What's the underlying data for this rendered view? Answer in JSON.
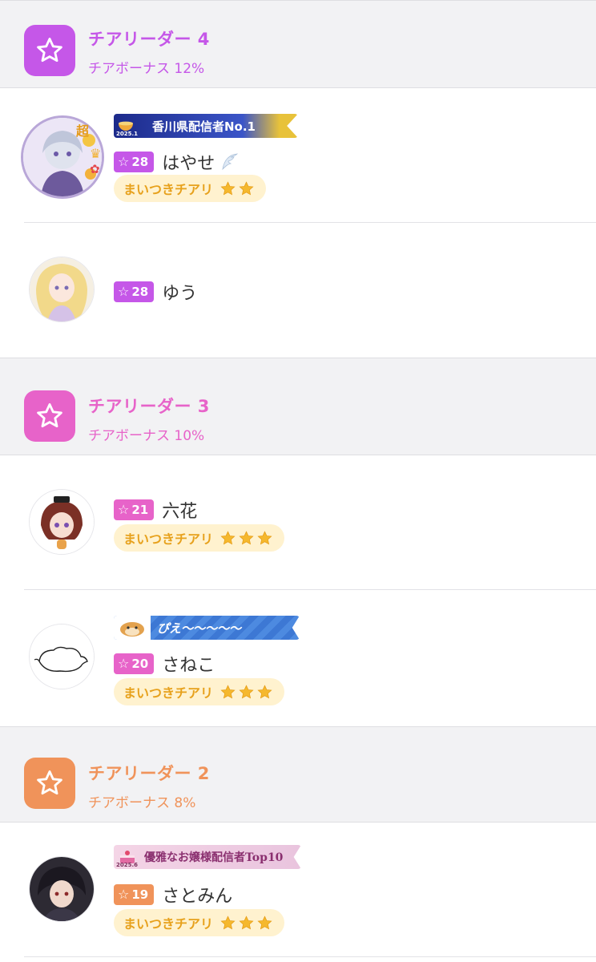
{
  "tiers": [
    {
      "title": "チアリーダー 4",
      "bonus": "チアボーナス 12%",
      "color": "#c557e8"
    },
    {
      "title": "チアリーダー 3",
      "bonus": "チアボーナス 10%",
      "color": "#e763c9"
    },
    {
      "title": "チアリーダー 2",
      "bonus": "チアボーナス 8%",
      "color": "#f0935a"
    }
  ],
  "users": [
    {
      "name": "はやせ",
      "level": "28",
      "badge_color": "#c557e8",
      "banner": "香川県配信者No.1",
      "banner_year": "2025.1",
      "cheer": "まいつきチアリ",
      "cheer_stars": 2,
      "avatar_icon": "user-avatar-anime-girl",
      "avatar_tag": "超"
    },
    {
      "name": "ゆう",
      "level": "28",
      "badge_color": "#c557e8"
    },
    {
      "name": "六花",
      "level": "21",
      "badge_color": "#e763c9",
      "cheer": "まいつきチアリ",
      "cheer_stars": 3
    },
    {
      "name": "さねこ",
      "level": "20",
      "badge_color": "#e763c9",
      "banner": "ぴえ〜〜〜〜〜",
      "cheer": "まいつきチアリ",
      "cheer_stars": 3
    },
    {
      "name": "さとみん",
      "level": "19",
      "badge_color": "#f0935a",
      "banner": "優雅なお嬢様配信者Top10",
      "banner_year": "2025.6",
      "cheer": "まいつきチアリ",
      "cheer_stars": 3
    }
  ]
}
